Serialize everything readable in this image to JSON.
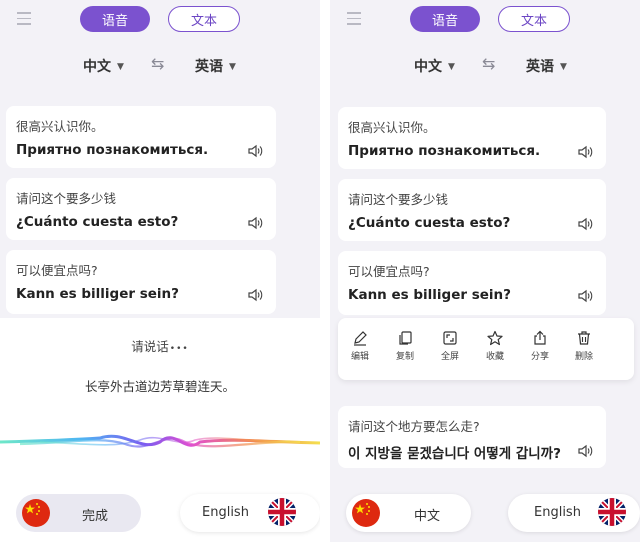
{
  "left_panel": {
    "tabs": {
      "voice": "语音",
      "text": "文本"
    },
    "langs": {
      "source": "中文",
      "target": "英语"
    },
    "cards": [
      {
        "source": "很高兴认识你。",
        "target": "Приятно познакомиться."
      },
      {
        "source": "请问这个要多少钱",
        "target": "¿Cuánto cuesta esto?"
      },
      {
        "source": "可以便宜点吗?",
        "target": "Kann es billiger sein?"
      }
    ],
    "listening": {
      "prompt": "请说话",
      "recognized": "长亭外古道边芳草碧连天。"
    },
    "bottom": {
      "done_label": "完成",
      "english_label": "English"
    }
  },
  "right_panel": {
    "tabs": {
      "voice": "语音",
      "text": "文本"
    },
    "langs": {
      "source": "中文",
      "target": "英语"
    },
    "cards": [
      {
        "source": "很高兴认识你。",
        "target": "Приятно познакомиться."
      },
      {
        "source": "请问这个要多少钱",
        "target": "¿Cuánto cuesta esto?"
      },
      {
        "source": "可以便宜点吗?",
        "target": "Kann es billiger sein?"
      },
      {
        "source": "请问这个地方要怎么走?",
        "target": "이 지방을 묻겠습니다 어떻게 갑니까?"
      }
    ],
    "actions": [
      {
        "label": "编辑",
        "icon": "edit-icon"
      },
      {
        "label": "复制",
        "icon": "copy-icon"
      },
      {
        "label": "全屏",
        "icon": "fullscreen-icon"
      },
      {
        "label": "收藏",
        "icon": "star-icon"
      },
      {
        "label": "分享",
        "icon": "share-icon"
      },
      {
        "label": "删除",
        "icon": "trash-icon"
      }
    ],
    "bottom": {
      "chinese_label": "中文",
      "english_label": "English"
    }
  },
  "colors": {
    "accent": "#7b52cf",
    "panel_bg": "#f3f2f7"
  }
}
